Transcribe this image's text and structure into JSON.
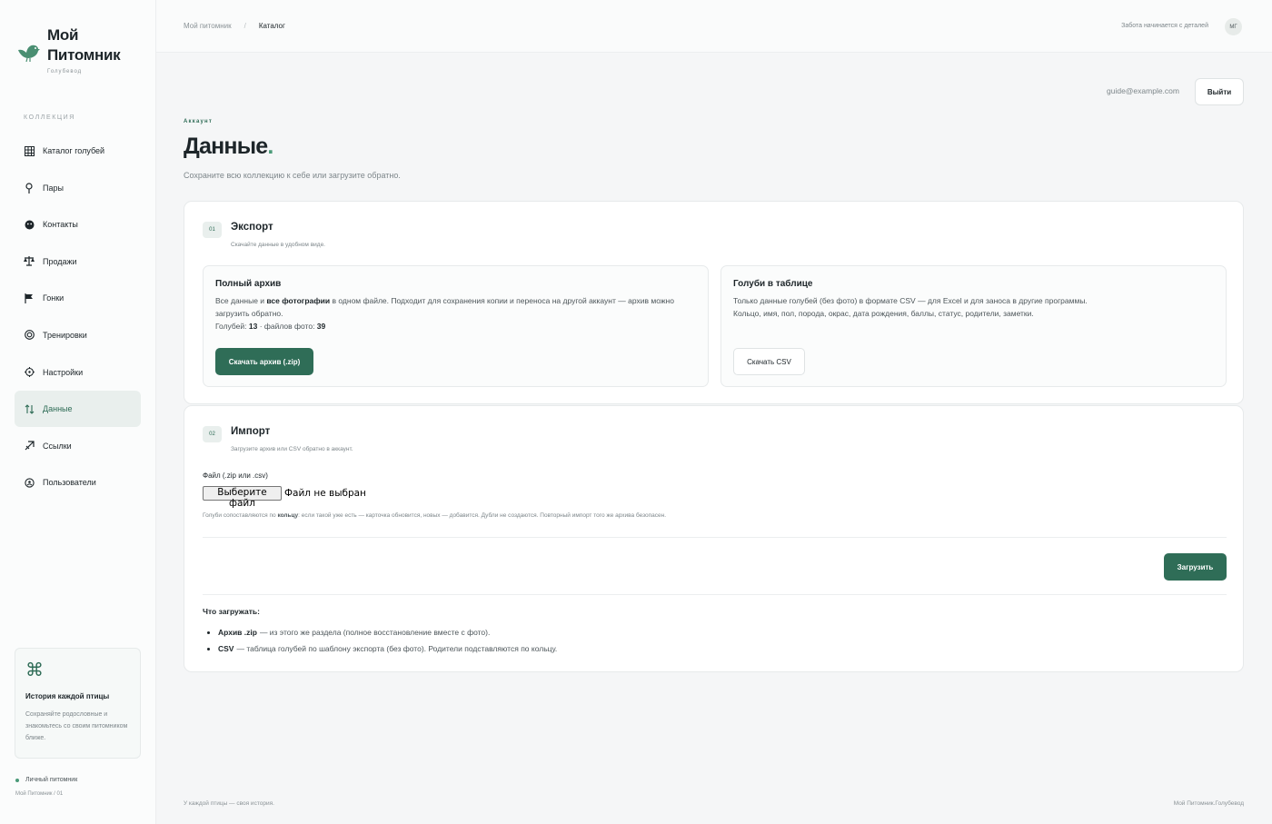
{
  "brand": {
    "title_line1": "Мой",
    "title_line2": "Питомник",
    "subtitle": "Голубевод"
  },
  "sidebar": {
    "heading": "КОЛЛЕКЦИЯ",
    "items": [
      {
        "label": "Каталог голубей",
        "icon": "grid-icon"
      },
      {
        "label": "Пары",
        "icon": "pin-icon"
      },
      {
        "label": "Контакты",
        "icon": "contacts-icon"
      },
      {
        "label": "Продажи",
        "icon": "scale-icon"
      },
      {
        "label": "Гонки",
        "icon": "flag-icon"
      },
      {
        "label": "Тренировки",
        "icon": "target-icon"
      },
      {
        "label": "Настройки",
        "icon": "gear-icon"
      },
      {
        "label": "Данные",
        "icon": "transfer-icon",
        "active": true
      },
      {
        "label": "Ссылки",
        "icon": "link-arrow-icon"
      },
      {
        "label": "Пользователи",
        "icon": "users-icon"
      }
    ],
    "promo": {
      "icon": "command-icon",
      "title": "История каждой птицы",
      "text": "Сохраняйте родословные и знакомьтесь со своим питомником ближе."
    },
    "footer": {
      "status": "Личный питомник",
      "version": "Мой Питомник / 01"
    }
  },
  "topbar": {
    "breadcrumb": [
      "Мой питомник",
      "Каталог"
    ],
    "separator": "/",
    "tagline": "Забота начинается с деталей",
    "avatar": "МГ"
  },
  "account": {
    "email": "guide@example.com",
    "logout_label": "Выйти"
  },
  "header": {
    "eyebrow": "Аккаунт",
    "title": "Данные",
    "title_dot": ".",
    "description": "Сохраните всю коллекцию к себе или загрузите обратно."
  },
  "export": {
    "step": "01",
    "title": "Экспорт",
    "subtitle": "Скачайте данные в удобном виде.",
    "full_archive": {
      "title": "Полный архив",
      "text_before": "Все данные и ",
      "text_bold": "все фотографии",
      "text_after": " в одном файле. Подходит для сохранения копии и переноса на другой аккаунт — архив можно загрузить обратно.",
      "pigeons_label": "Голубей: ",
      "pigeons_count": "13",
      "photos_label": " · файлов фото: ",
      "photos_count": "39",
      "button": "Скачать архив (.zip)"
    },
    "table": {
      "title": "Голуби в таблице",
      "line1": "Только данные голубей (без фото) в формате CSV — для Excel и для заноса в другие программы.",
      "line2": "Кольцо, имя, пол, порода, окрас, дата рождения, баллы, статус, родители, заметки.",
      "button": "Скачать CSV"
    }
  },
  "import": {
    "step": "02",
    "title": "Импорт",
    "subtitle": "Загрузите архив или CSV обратно в аккаунт.",
    "file_label": "Файл (.zip или .csv)",
    "file_button": "Выберите файл",
    "file_status": "Файл не выбран",
    "hint_before": "Голуби сопоставляются по ",
    "hint_bold": "кольцу",
    "hint_after": ": если такой уже есть — карточка обновится, новых — добавится. Дубли не создаются. Повторный импорт того же архива безопасен.",
    "upload_button": "Загрузить",
    "what_title": "Что загружать:",
    "what_items": [
      {
        "bold": "Архив .zip",
        "text": "— из этого же раздела (полное восстановление вместе с фото)."
      },
      {
        "bold": "CSV",
        "text": "— таблица голубей по шаблону экспорта (без фото). Родители подставляются по кольцу."
      }
    ]
  },
  "footer": {
    "left": "У каждой птицы — своя история.",
    "right": "Мой Питомник.Голубевод"
  },
  "colors": {
    "accent": "#2f6d57",
    "accent_soft": "#e9efed",
    "background": "#f5f6f7",
    "text": "#1d2529"
  }
}
